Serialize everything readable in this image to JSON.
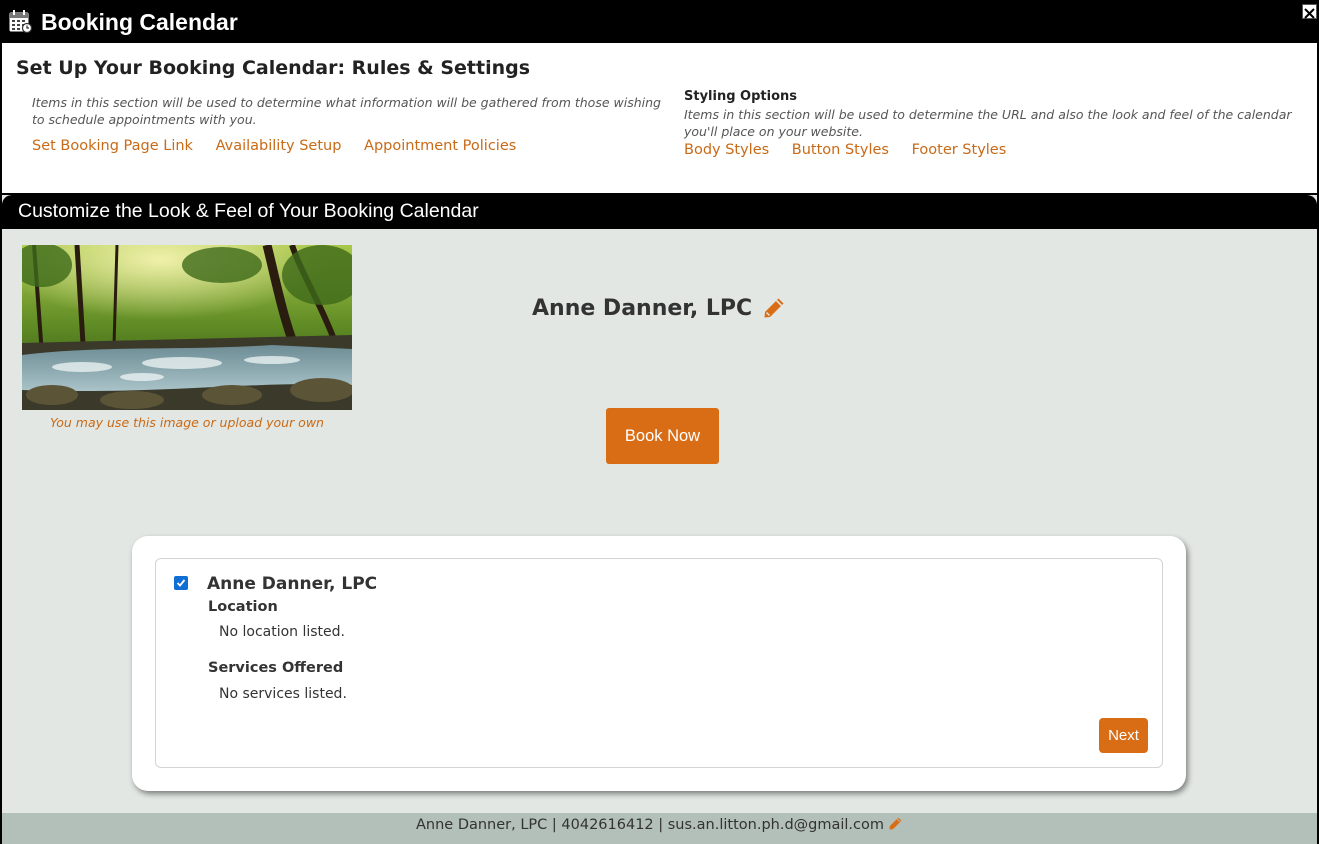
{
  "window": {
    "title": "Booking Calendar",
    "close_label": "X"
  },
  "setup": {
    "heading": "Set Up Your Booking Calendar: Rules & Settings",
    "rules_description": "Items in this section will be used to determine what information will be gathered from those wishing to schedule appointments with you.",
    "rules_links": [
      "Set Booking Page Link",
      "Availability Setup",
      "Appointment Policies"
    ],
    "styling_heading": "Styling Options",
    "styling_description": "Items in this section will be used to determine the URL and also the look and feel of the calendar you'll place on your website.",
    "styling_links": [
      "Body Styles",
      "Button Styles",
      "Footer Styles"
    ]
  },
  "customize": {
    "heading": "Customize the Look & Feel of Your Booking Calendar"
  },
  "preview": {
    "image_caption": "You may use this image or upload your own",
    "provider_name": "Anne Danner, LPC",
    "book_button": "Book Now",
    "card": {
      "checked": true,
      "provider_name": "Anne Danner, LPC",
      "location_heading": "Location",
      "location_value": "No location listed.",
      "services_heading": "Services Offered",
      "services_value": "No services listed.",
      "next_button": "Next"
    },
    "footer_text": "Anne Danner, LPC | 4042616412 | sus.an.litton.ph.d@gmail.com"
  },
  "colors": {
    "accent": "#d86d16",
    "link": "#c96a16",
    "preview_background": "#e2e7e4",
    "footer_background": "#b3bfb9",
    "checkbox": "#0f6fd4"
  },
  "icons": {
    "window": "calendar-icon",
    "close": "close-icon",
    "edit": "pencil-icon"
  }
}
